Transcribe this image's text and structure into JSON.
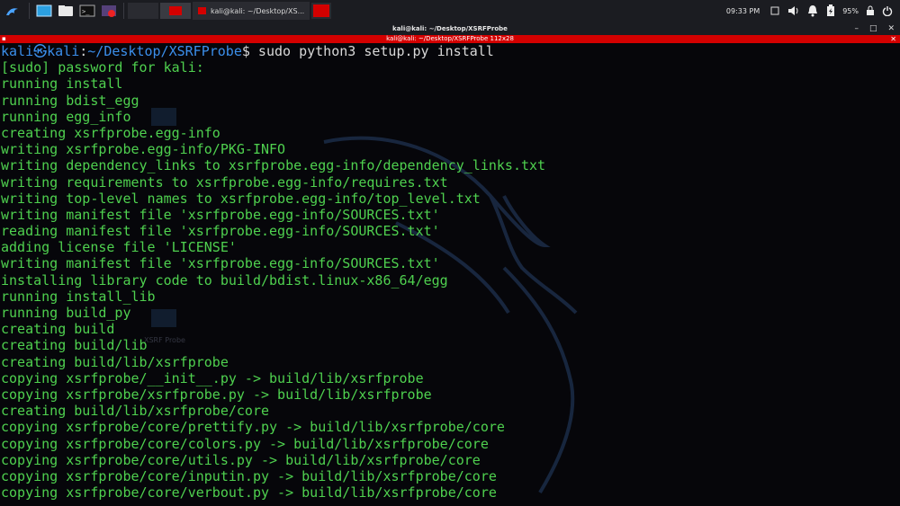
{
  "panel": {
    "clock": "09:33 PM",
    "battery": "95%",
    "task_label": "kali@kali: ~/Desktop/XS..."
  },
  "window": {
    "title": "kali@kali: ~/Desktop/XSRFProbe",
    "tab_title": "kali@kali: ~/Desktop/XSRFProbe 112x28"
  },
  "desktop": {
    "icon_label": "XSRF Probe"
  },
  "colors": {
    "output": "#4fd14f",
    "prompt": "#3b8eea",
    "tabbar": "#d30000"
  },
  "terminal": {
    "prompt": {
      "user": "kali㉿kali",
      "colon": ":",
      "path": "~/Desktop/XSRFProbe",
      "sym": "$",
      "cmd": " sudo python3 setup.py install"
    },
    "lines": [
      "[sudo] password for kali:",
      "running install",
      "running bdist_egg",
      "running egg_info",
      "creating xsrfprobe.egg-info",
      "writing xsrfprobe.egg-info/PKG-INFO",
      "writing dependency_links to xsrfprobe.egg-info/dependency_links.txt",
      "writing requirements to xsrfprobe.egg-info/requires.txt",
      "writing top-level names to xsrfprobe.egg-info/top_level.txt",
      "writing manifest file 'xsrfprobe.egg-info/SOURCES.txt'",
      "reading manifest file 'xsrfprobe.egg-info/SOURCES.txt'",
      "adding license file 'LICENSE'",
      "writing manifest file 'xsrfprobe.egg-info/SOURCES.txt'",
      "installing library code to build/bdist.linux-x86_64/egg",
      "running install_lib",
      "running build_py",
      "creating build",
      "creating build/lib",
      "creating build/lib/xsrfprobe",
      "copying xsrfprobe/__init__.py -> build/lib/xsrfprobe",
      "copying xsrfprobe/xsrfprobe.py -> build/lib/xsrfprobe",
      "creating build/lib/xsrfprobe/core",
      "copying xsrfprobe/core/prettify.py -> build/lib/xsrfprobe/core",
      "copying xsrfprobe/core/colors.py -> build/lib/xsrfprobe/core",
      "copying xsrfprobe/core/utils.py -> build/lib/xsrfprobe/core",
      "copying xsrfprobe/core/inputin.py -> build/lib/xsrfprobe/core",
      "copying xsrfprobe/core/verbout.py -> build/lib/xsrfprobe/core"
    ]
  }
}
